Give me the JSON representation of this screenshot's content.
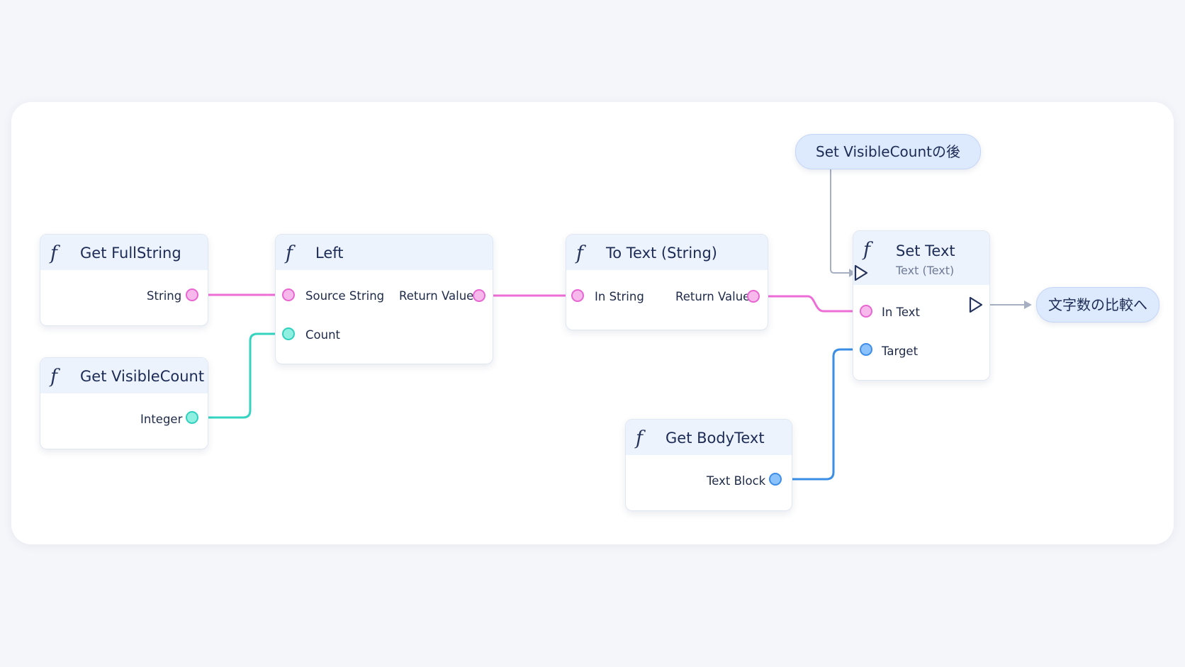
{
  "nodes": {
    "get_fullstring": {
      "icon": "function-icon",
      "title": "Get FullString",
      "output_pin": "String"
    },
    "get_visiblecount": {
      "icon": "function-icon",
      "title": "Get VisibleCount",
      "output_pin": "Integer"
    },
    "left": {
      "icon": "function-icon",
      "title": "Left",
      "input_source": "Source String",
      "input_count": "Count",
      "output": "Return Value"
    },
    "to_text": {
      "icon": "function-icon",
      "title": "To Text (String)",
      "input": "In String",
      "output": "Return Value"
    },
    "set_text": {
      "icon": "function-icon",
      "title": "Set Text",
      "subtitle": "Text (Text)",
      "input_text": "In Text",
      "input_target": "Target"
    },
    "get_bodytext": {
      "icon": "function-icon",
      "title": "Get BodyText",
      "output_pin": "Text Block"
    }
  },
  "pills": {
    "event_in": "Set VisibleCountの後",
    "event_out": "文字数の比較へ"
  },
  "colors": {
    "string_wire": "#ee6ed8",
    "integer_wire": "#34d4c0",
    "object_wire": "#3a8ee6",
    "exec_wire": "#a7b0c2",
    "node_header": "#edf3fd",
    "pill_bg": "#dde9fc"
  }
}
